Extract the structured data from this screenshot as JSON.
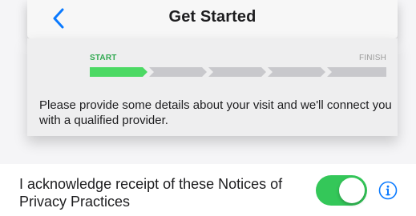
{
  "header": {
    "title": "Get Started",
    "back_icon": "chevron-left-icon"
  },
  "progress": {
    "start_label": "START",
    "finish_label": "FINISH",
    "total_steps": 5,
    "completed_steps": 1,
    "active_color": "#4cd964",
    "inactive_color": "#c8c8cc"
  },
  "intro": {
    "text": "Please provide some details about your visit and we'll connect you with a qualified provider."
  },
  "acknowledgement": {
    "label": "I acknowledge receipt of these Notices of Privacy Practices",
    "toggle_on": true,
    "toggle_color": "#34c759",
    "info_icon": "info-circle-icon"
  },
  "colors": {
    "accent": "#0a7aff",
    "background": "#f5f5f7"
  }
}
